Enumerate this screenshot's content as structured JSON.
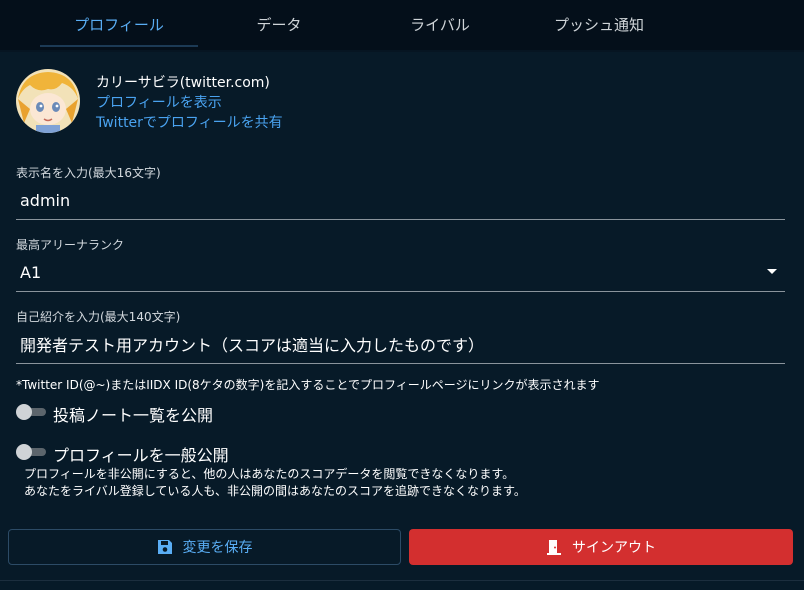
{
  "tabs": [
    {
      "label": "プロフィール",
      "active": true
    },
    {
      "label": "データ",
      "active": false
    },
    {
      "label": "ライバル",
      "active": false
    },
    {
      "label": "プッシュ通知",
      "active": false
    }
  ],
  "profile": {
    "name": "カリーサビラ(twitter.com)",
    "view_link": "プロフィールを表示",
    "share_link": "Twitterでプロフィールを共有"
  },
  "form": {
    "display_name": {
      "label": "表示名を入力(最大16文字)",
      "value": "admin"
    },
    "arena_rank": {
      "label": "最高アリーナランク",
      "value": "A1"
    },
    "bio": {
      "label": "自己紹介を入力(最大140文字)",
      "value": "開発者テスト用アカウント（スコアは適当に入力したものです）"
    },
    "note": "*Twitter ID(@~)またはIIDX ID(8ケタの数字)を記入することでプロフィールページにリンクが表示されます"
  },
  "toggles": {
    "public_notes": {
      "label": "投稿ノート一覧を公開",
      "on": false
    },
    "public_profile": {
      "label": "プロフィールを一般公開",
      "on": false,
      "desc1": "プロフィールを非公開にすると、他の人はあなたのスコアデータを閲覧できなくなります。",
      "desc2": "あなたをライバル登録している人も、非公開の間はあなたのスコアを追跡できなくなります。"
    }
  },
  "buttons": {
    "save_label": "変更を保存",
    "signout_label": "サインアウト"
  },
  "colors": {
    "accent": "#5aaef5",
    "link": "#4aa3f0",
    "danger": "#d32f2f",
    "background": "#071a28"
  },
  "icons": {
    "save": "save-icon",
    "signout": "door-exit-icon",
    "dropdown": "caret-down-icon"
  }
}
